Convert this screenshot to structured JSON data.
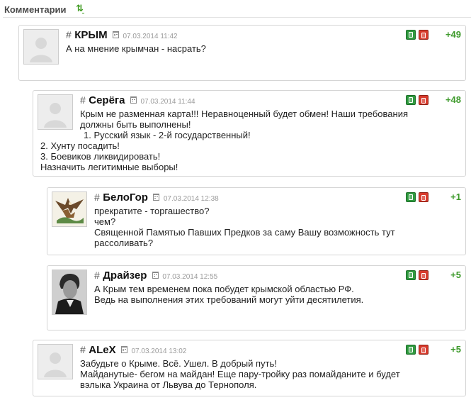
{
  "header": {
    "title": "Комментарии",
    "refresh_icon_glyph": "⇅"
  },
  "comments": [
    {
      "hash": "#",
      "author": "КРЫМ",
      "date": "07.03.2014 11:42",
      "score": "+49",
      "avatar": "default-avatar",
      "lines": [
        "А на мнение крымчан - насрать?"
      ]
    },
    {
      "hash": "#",
      "author": "Серёга",
      "date": "07.03.2014 11:44",
      "score": "+48",
      "avatar": "default-avatar",
      "lines": [
        "Крым не разменная карта!!! Неравноценный будет обмен! Наши требования",
        "должны быть выполнены!",
        "  1. Русский язык - 2-й государственный!",
        "2. Хунту посадить!",
        "3. Боевиков ликвидировать!",
        "Назначить легитимные выборы!"
      ]
    },
    {
      "hash": "#",
      "author": "БелоГор",
      "date": "07.03.2014 12:38",
      "score": "+1",
      "avatar": "eagle-avatar",
      "lines": [
        "прекратите - торгашество?",
        "чем?",
        "Священной Памятью Павших Предков за саму Вашу возможность тут",
        "рассоливать?"
      ]
    },
    {
      "hash": "#",
      "author": "Драйзер",
      "date": "07.03.2014 12:55",
      "score": "+5",
      "avatar": "portrait-avatar",
      "lines": [
        "А Крым тем временем пока побудет крымской областью РФ.",
        "Ведь на выполнения этих требований могут уйти десятилетия."
      ]
    },
    {
      "hash": "#",
      "author": "ALeX",
      "date": "07.03.2014 13:02",
      "score": "+5",
      "avatar": "default-avatar",
      "lines": [
        "Забудьте о Крыме. Всё. Ушел. В добрый путь!",
        "Майданутые- бегом на майдан! Еще пару-тройку раз помайданите и будет",
        "вэлыка Украина от Львува до Тернополя."
      ]
    }
  ],
  "colors": {
    "score": "#3e9a2c",
    "vote_up": "#2f9a3f",
    "vote_down": "#d73a2c",
    "border": "#d5d5d5",
    "date": "#9a9a9a"
  }
}
